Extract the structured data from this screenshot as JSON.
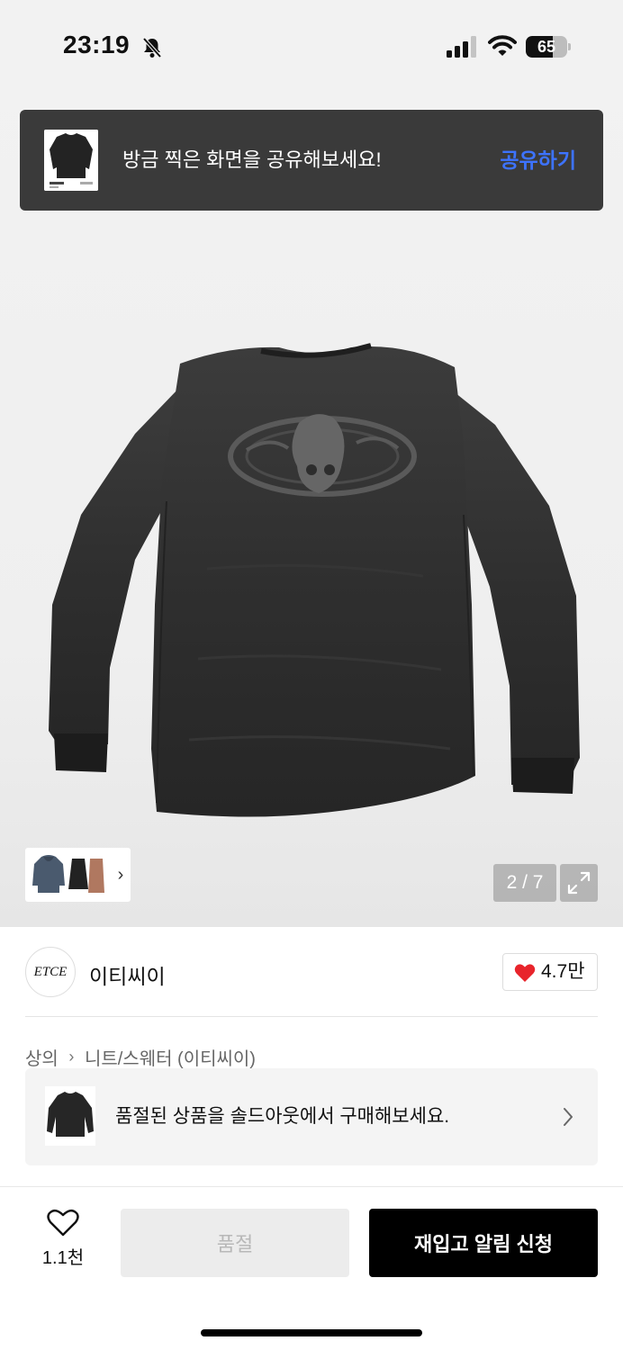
{
  "status_bar": {
    "time": "23:19",
    "battery": "65",
    "battery_level": 0.65,
    "icons": [
      "bell-slash-icon",
      "signal-icon",
      "wifi-icon",
      "battery-icon"
    ]
  },
  "share_toast": {
    "message": "방금 찍은 화면을 공유해보세요!",
    "action": "공유하기",
    "action_color": "#3d73ff"
  },
  "gallery": {
    "counter": "2 / 7",
    "current": 2,
    "total": 7
  },
  "brand": {
    "logo_text": "ETCE",
    "name": "이티씨이",
    "likes": "4.7만"
  },
  "breadcrumb": {
    "category": "상의",
    "subcategory": "니트/스웨터 (이티씨이)"
  },
  "soldout_banner": {
    "text": "품절된 상품을 솔드아웃에서 구매해보세요."
  },
  "bottom_bar": {
    "wish_count": "1.1천",
    "soldout_label": "품절",
    "restock_label": "재입고 알림 신청"
  },
  "colors": {
    "accent_blue": "#3d73ff",
    "heart_red": "#e8242b",
    "primary_button": "#000000",
    "disabled_button": "#ececec"
  }
}
